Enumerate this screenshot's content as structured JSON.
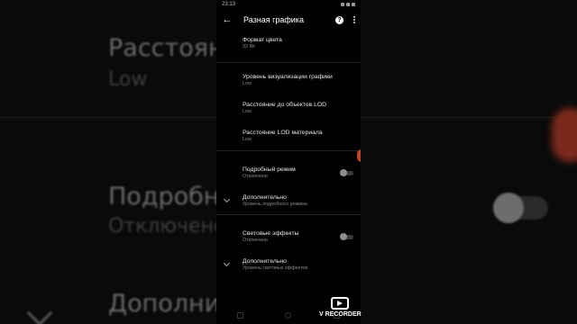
{
  "background": {
    "title1": "Расстояни",
    "sub1": "Low",
    "title2": "Подробны",
    "sub2": "Отключено",
    "title3": "Дополните"
  },
  "status_bar": {
    "time": "23:13"
  },
  "header": {
    "title": "Разная графика",
    "back_icon": "arrow-left-icon",
    "help_icon": "help-circle-icon",
    "more_icon": "more-vert-icon"
  },
  "settings": [
    {
      "title": "Формат цвета",
      "summary": "32 Bit"
    },
    {
      "title": "Уровень визуализации графики",
      "summary": "Low"
    },
    {
      "title": "Расстояние до объектов LOD",
      "summary": "Low"
    },
    {
      "title": "Расстояние LOD материала",
      "summary": "Low"
    },
    {
      "title": "Подробный режим",
      "summary": "Отключено",
      "toggle": false
    },
    {
      "title": "Дополнительно",
      "summary": "Уровень подробного режима"
    },
    {
      "title": "Световые эффекты",
      "summary": "Отключено",
      "toggle": false
    },
    {
      "title": "Дополнительно",
      "summary": "Уровень световых эффектов"
    }
  ],
  "recorder": {
    "label": "V RECORDER",
    "icon": "video-play-icon"
  },
  "colors": {
    "background": "#000000",
    "accent": "#c0442a"
  }
}
